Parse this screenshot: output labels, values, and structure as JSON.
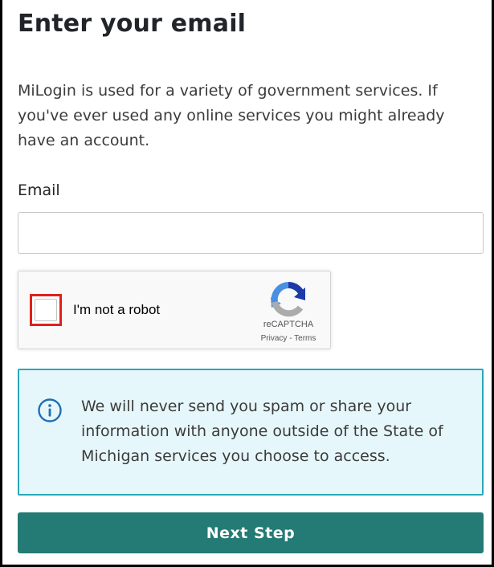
{
  "page": {
    "title": "Enter your email",
    "intro": "MiLogin is used for a variety of government services. If you've ever used any online services you might already have an account."
  },
  "form": {
    "email_label": "Email",
    "email_value": "",
    "email_placeholder": ""
  },
  "recaptcha": {
    "checkbox_label": "I'm not a robot",
    "checked": false,
    "brand": "reCAPTCHA",
    "privacy_link": "Privacy",
    "separator": "-",
    "terms_link": "Terms",
    "logo_icon": "recaptcha-logo-icon",
    "highlight_color": "#e0201a"
  },
  "notice": {
    "icon": "info-icon",
    "text": "We will never send you spam or share your information with anyone outside of the State of Michigan services you choose to access.",
    "accent_color": "#2aa7b8",
    "background_color": "#e6f7fb"
  },
  "actions": {
    "next_label": "Next Step",
    "button_color": "#247a74"
  }
}
